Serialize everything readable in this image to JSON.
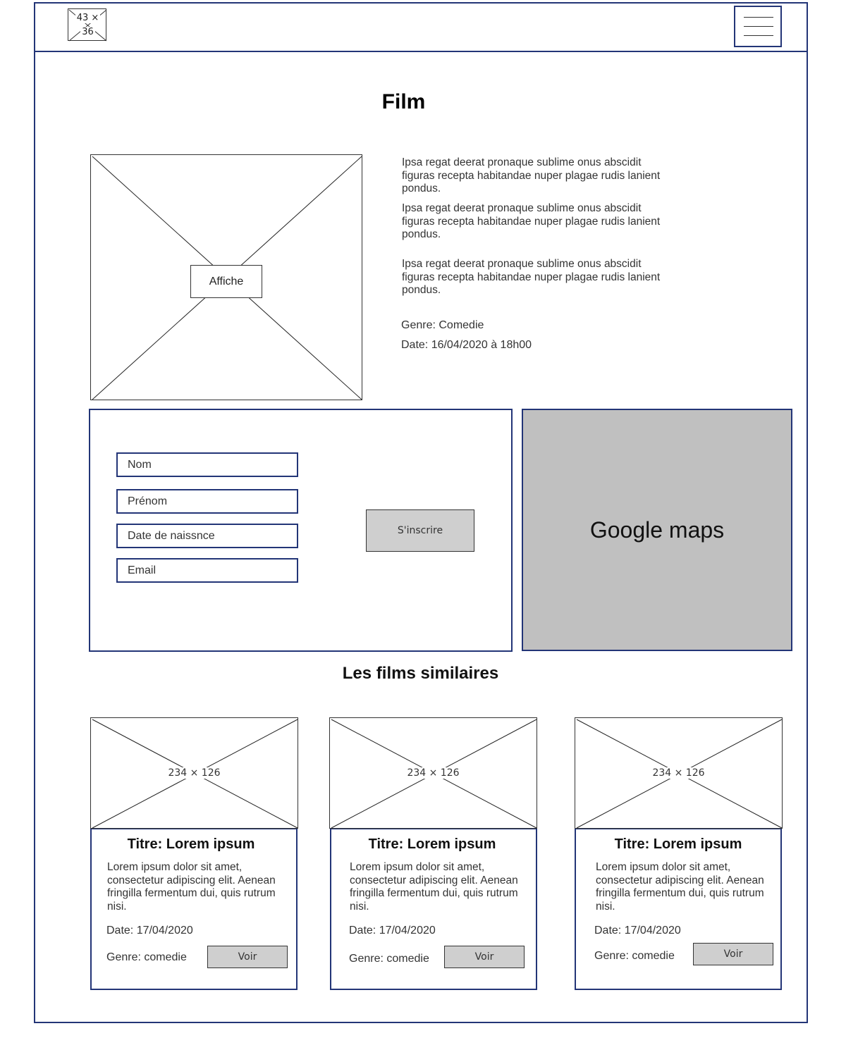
{
  "header": {
    "logo": {
      "line1": "43 ×",
      "line2": "36"
    },
    "menu_icon": "hamburger-menu-icon"
  },
  "page_title": "Film",
  "poster": {
    "label": "Affiche"
  },
  "description": {
    "paragraphs": [
      "Ipsa  regat deerat pronaque sublime onus abscidit figuras recepta habitandae nuper plagae rudis lanient pondus.",
      "Ipsa  regat deerat pronaque sublime onus abscidit figuras recepta habitandae nuper plagae rudis lanient pondus.",
      "Ipsa  regat deerat pronaque sublime onus abscidit figuras recepta habitandae nuper plagae rudis lanient pondus."
    ],
    "genre": "Genre: Comedie",
    "date": "Date: 16/04/2020 à 18h00"
  },
  "form": {
    "fields": [
      "Nom",
      "Prénom",
      "Date de naissnce",
      "Email"
    ],
    "submit_label": "S'inscrire"
  },
  "map": {
    "label": "Google maps"
  },
  "similar": {
    "title": "Les films similaires",
    "cards": [
      {
        "image_label": "234 × 126",
        "title": "Titre: Lorem ipsum",
        "text": "Lorem ipsum dolor sit amet, consectetur adipiscing elit. Aenean fringilla fermentum dui, quis rutrum nisi.",
        "date": "Date: 17/04/2020",
        "genre": "Genre: comedie",
        "button": "Voir"
      },
      {
        "image_label": "234 × 126",
        "title": "Titre: Lorem ipsum",
        "text": "Lorem ipsum dolor sit amet, consectetur adipiscing elit. Aenean fringilla fermentum dui, quis rutrum nisi.",
        "date": "Date: 17/04/2020",
        "genre": "Genre: comedie",
        "button": "Voir"
      },
      {
        "image_label": "234 × 126",
        "title": "Titre: Lorem ipsum",
        "text": "Lorem ipsum dolor sit amet, consectetur adipiscing elit. Aenean fringilla fermentum dui, quis rutrum nisi.",
        "date": "Date: 17/04/2020",
        "genre": "Genre: comedie",
        "button": "Voir"
      }
    ]
  },
  "colors": {
    "frame": "#233577",
    "map_bg": "#c0c0c0",
    "button_bg": "#cfcfcf"
  }
}
